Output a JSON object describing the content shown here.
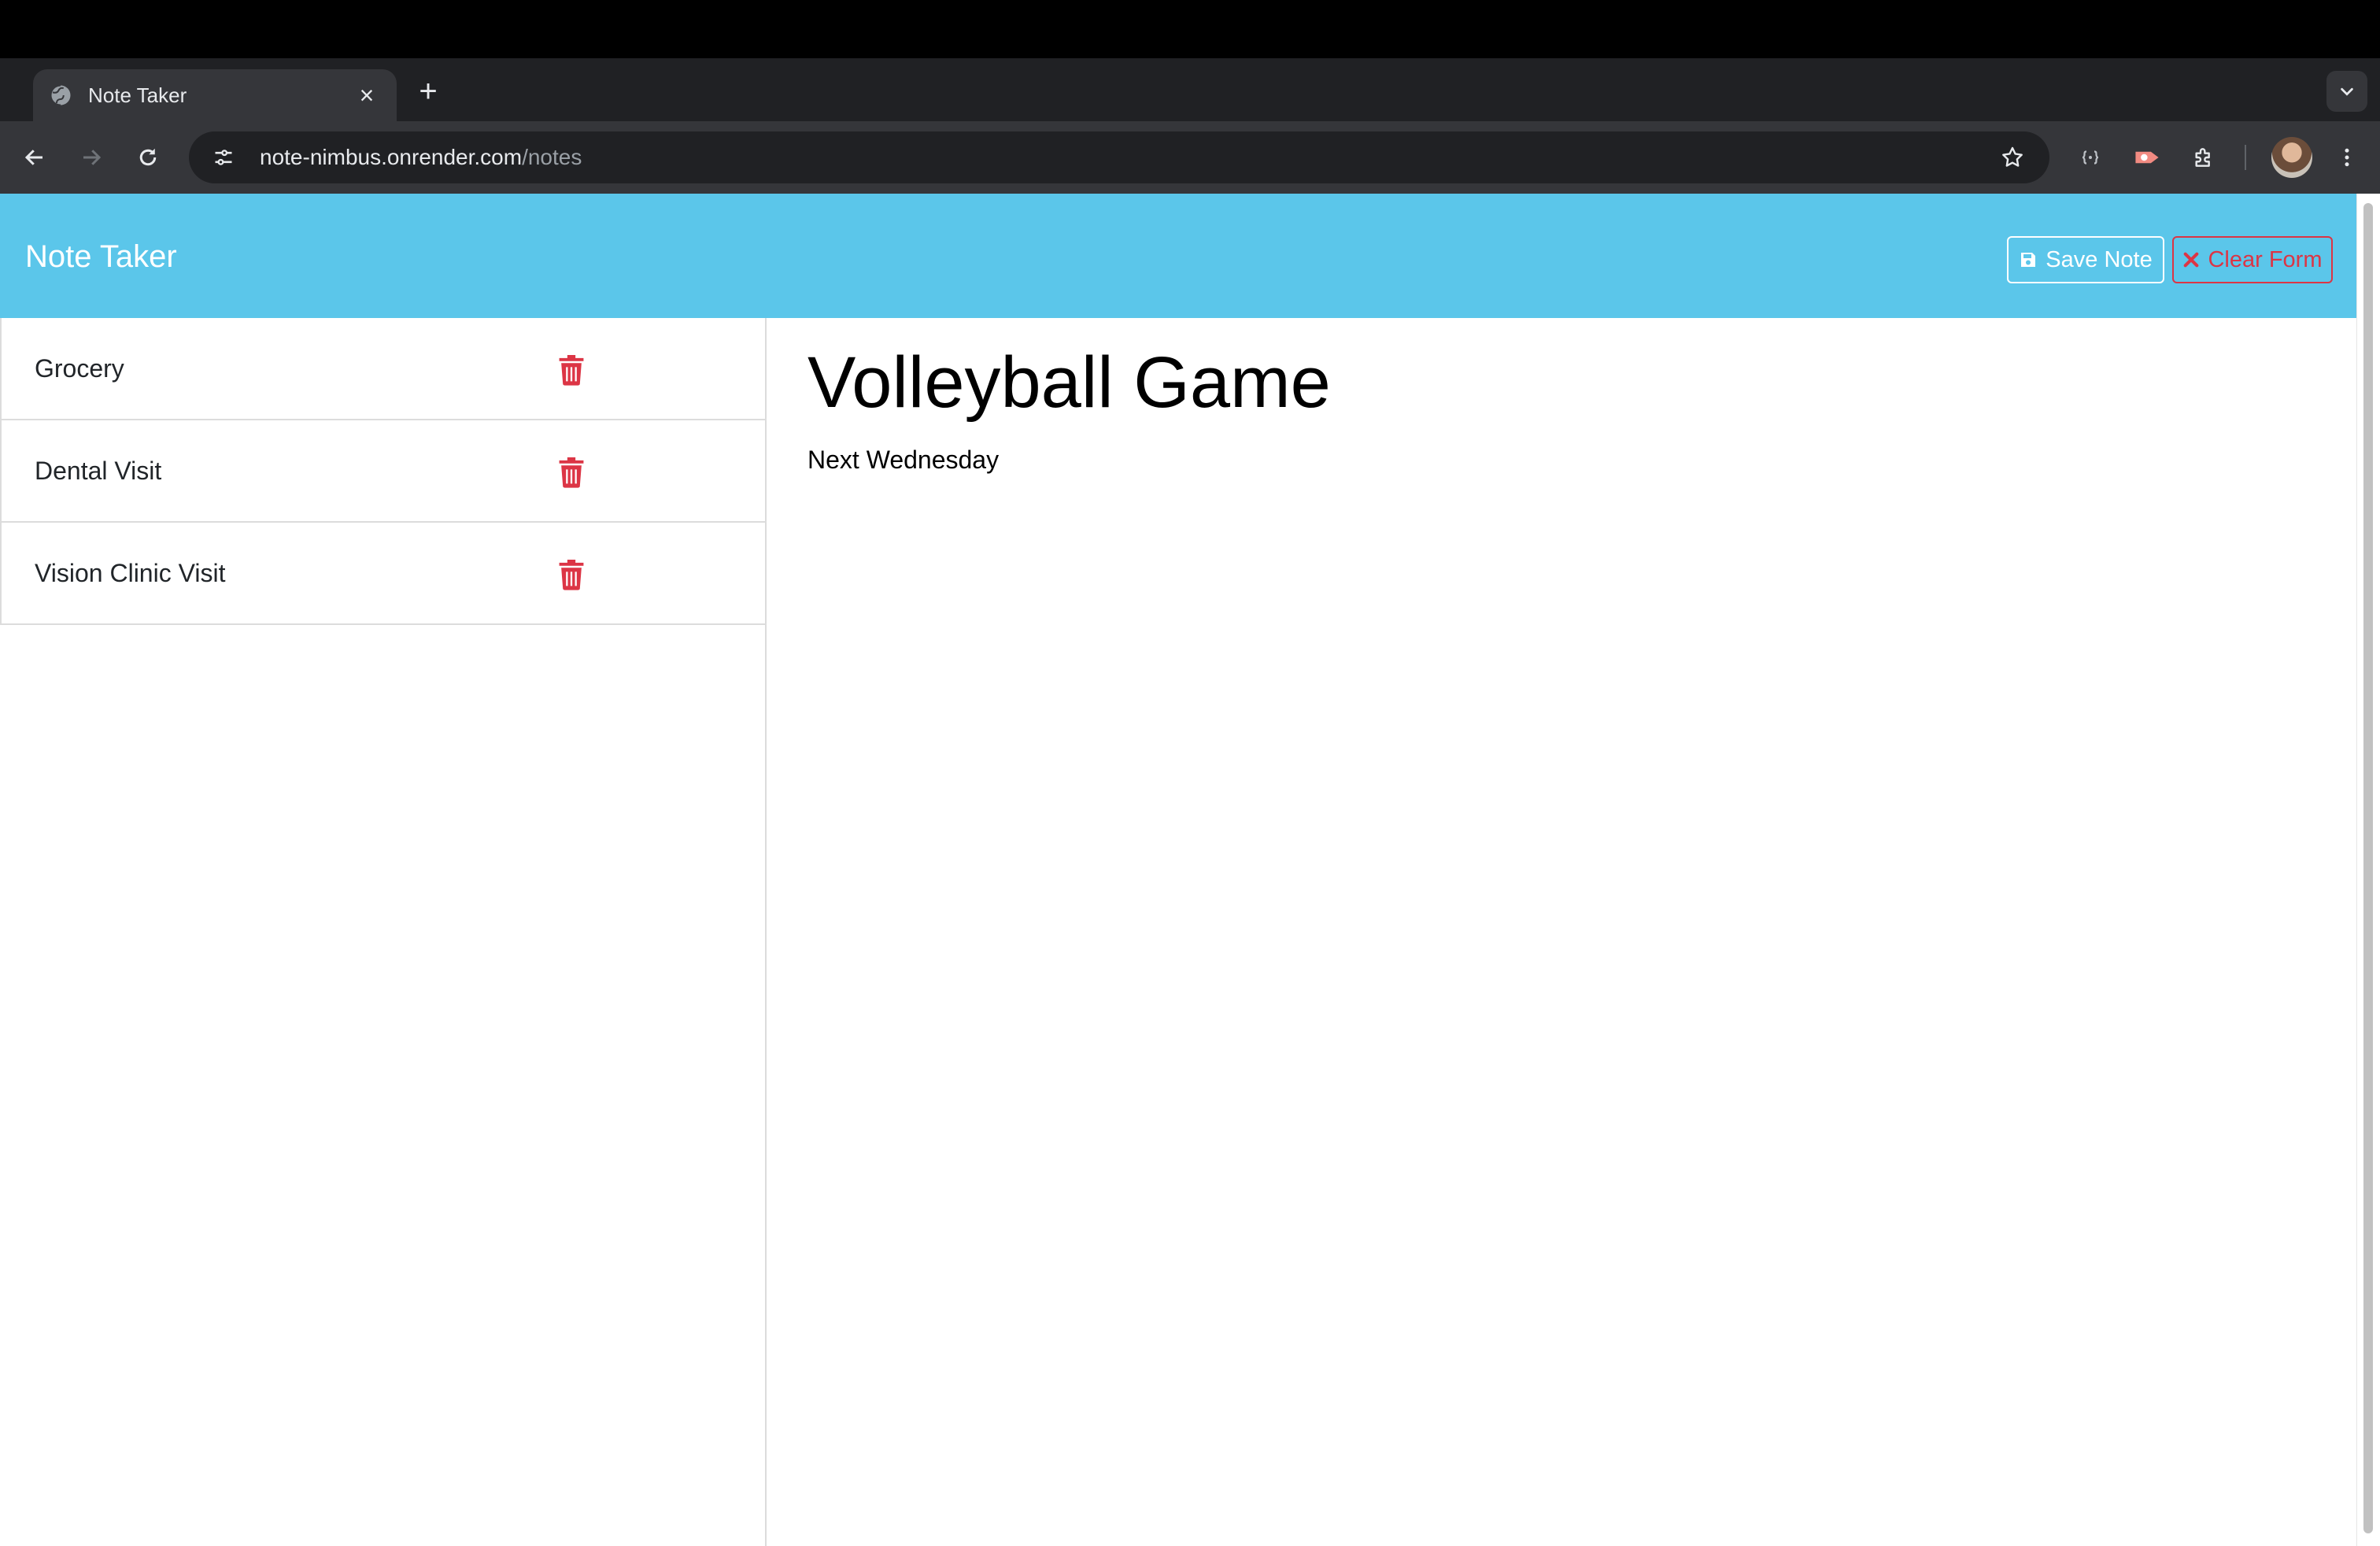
{
  "browser": {
    "tab_title": "Note Taker",
    "tab_close": "×",
    "new_tab": "+",
    "url_host": "note-nimbus.onrender.com",
    "url_path": "/notes"
  },
  "app": {
    "brand": "Note Taker",
    "save_label": "Save Note",
    "clear_label": "Clear Form",
    "accent_color": "#5bc6ea",
    "danger_color": "#dc3545"
  },
  "notes": [
    {
      "title": "Grocery"
    },
    {
      "title": "Dental Visit"
    },
    {
      "title": "Vision Clinic Visit"
    }
  ],
  "active_note": {
    "title": "Volleyball Game",
    "text": "Next Wednesday"
  }
}
